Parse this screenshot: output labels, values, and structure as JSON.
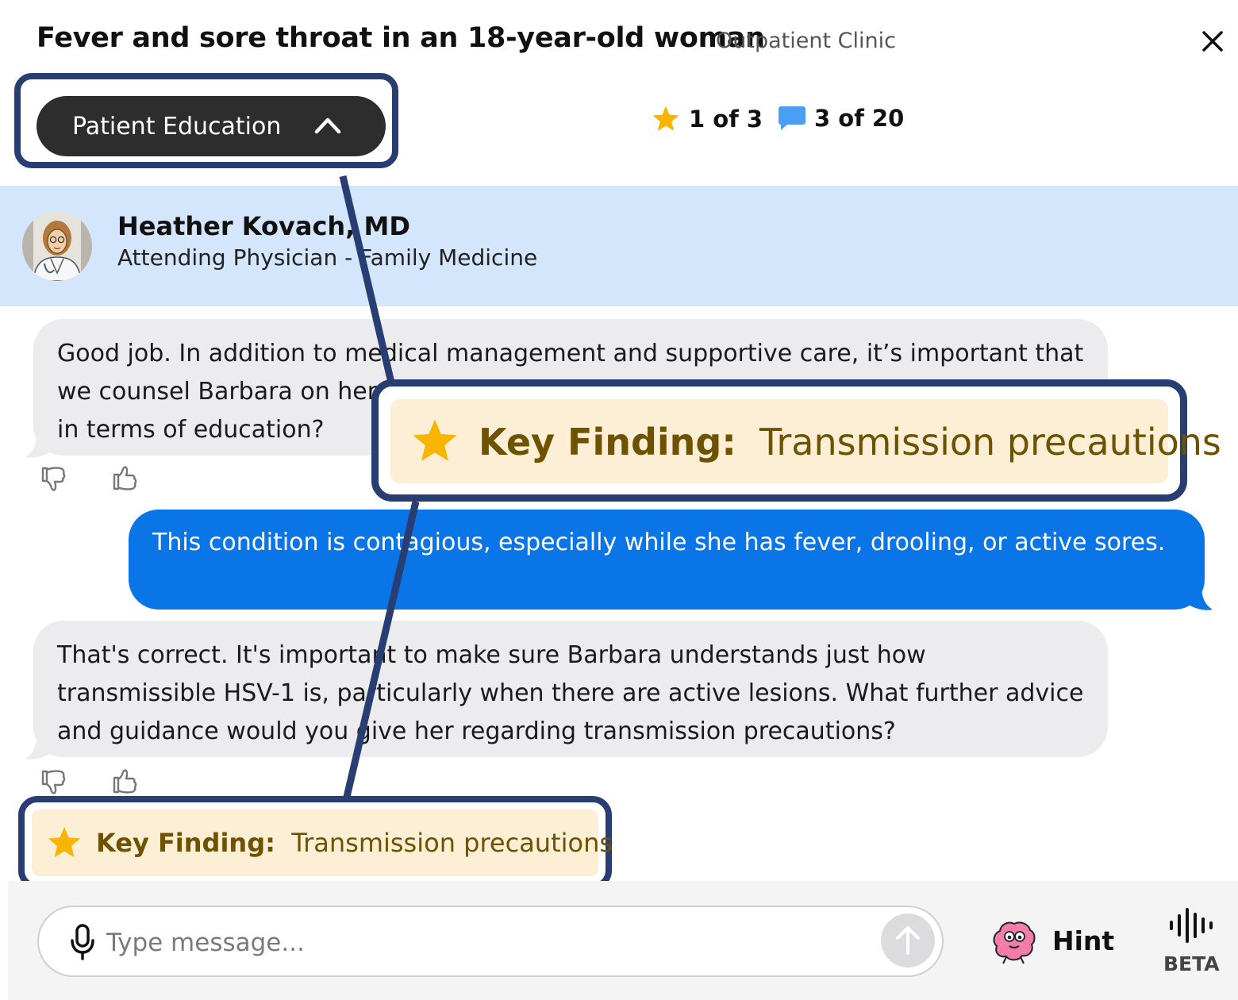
{
  "header": {
    "title": "Fever and sore throat in an 18-year-old woman",
    "setting": "Outpatient Clinic",
    "close_icon": "close-icon"
  },
  "section": {
    "label": "Patient Education",
    "icon": "chevron-up-icon"
  },
  "counters": {
    "key_findings": "1 of 3",
    "key_findings_icon": "star-icon",
    "messages": "3 of 20",
    "messages_icon": "chat-bubble-icon"
  },
  "attending": {
    "name": "Heather Kovach, MD",
    "role": "Attending Physician - Family Medicine"
  },
  "messages": [
    {
      "from": "attending",
      "text": "Good job. In addition to medical management and supportive care, it’s important that we counsel Barbara on her new diagnosis. What would you want to discuss with her in terms of education?"
    },
    {
      "from": "user",
      "text": "This condition is contagious, especially while she has fever, drooling, or active sores."
    },
    {
      "from": "attending",
      "text": "That's correct. It's important to make sure Barbara understands just how transmissible HSV-1 is, particularly when there are active lesions. What further advice and guidance would you give her regarding transmission precautions?"
    }
  ],
  "key_finding": {
    "label": "Key Finding:",
    "value": "Transmission precautions"
  },
  "composer": {
    "placeholder": "Type message...",
    "hint_label": "Hint",
    "voice_label": "BETA"
  },
  "colors": {
    "user_bubble": "#0a75e6",
    "attending_bubble": "#ececee",
    "banner": "#d4e6fb",
    "key_finding_bg": "#fcefd6",
    "key_finding_text": "#6e5200",
    "callout_border": "#283e72",
    "star": "#f7b500"
  }
}
